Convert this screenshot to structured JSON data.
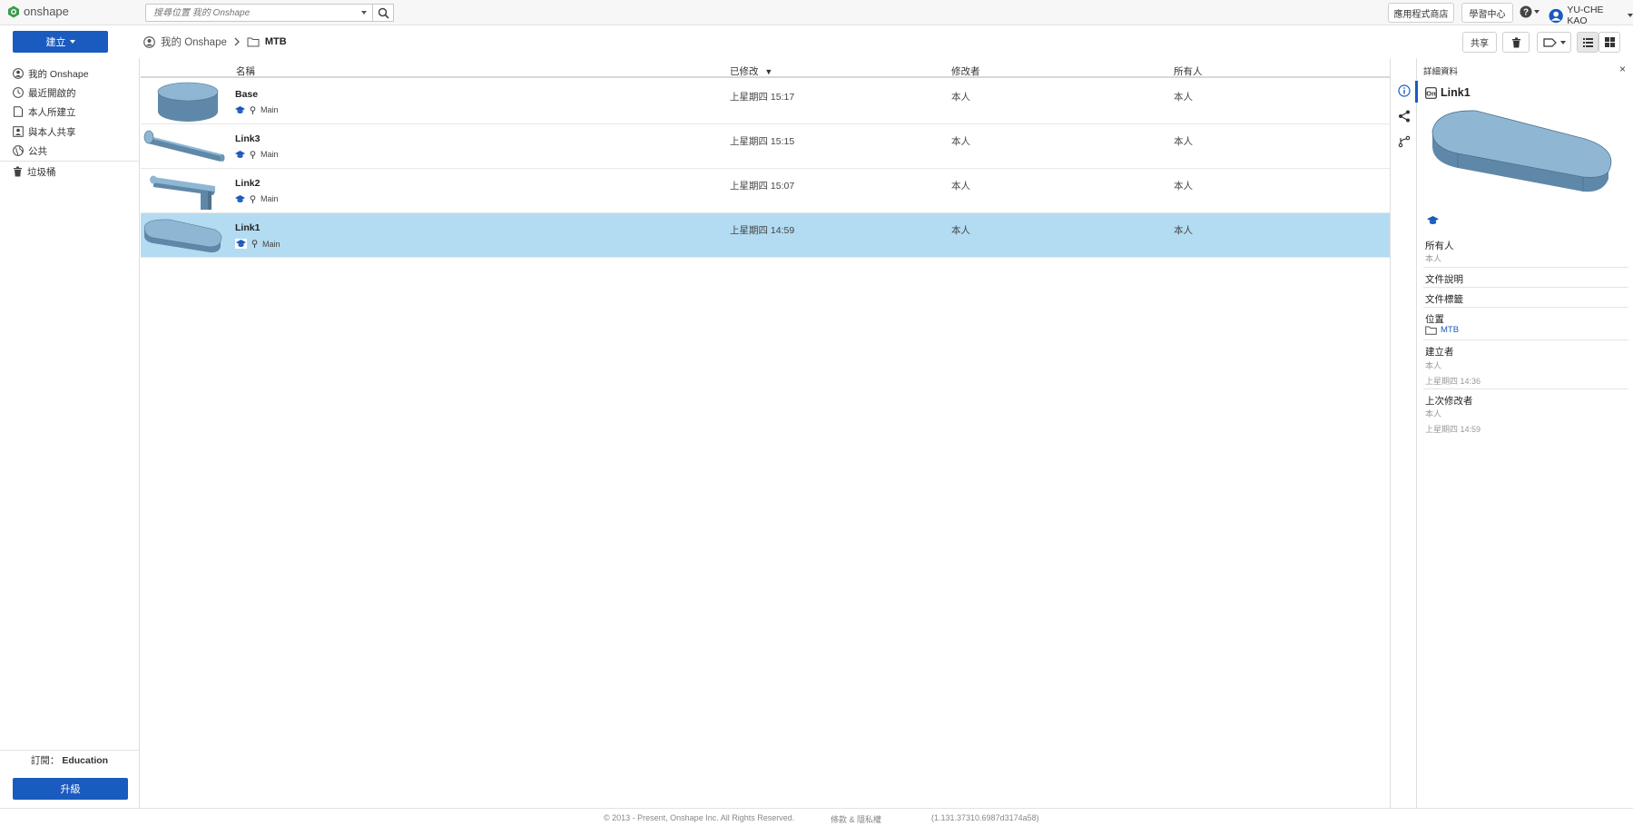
{
  "app": {
    "name": "onshape"
  },
  "search": {
    "placeholder": "搜尋位置 我的 Onshape"
  },
  "topbar": {
    "app_store_label": "應用程式商店",
    "learning_label": "學習中心",
    "user_name": "YU-CHE KAO"
  },
  "toolbar": {
    "create_label": "建立",
    "share_label": "共享"
  },
  "breadcrumb": {
    "root": "我的 Onshape",
    "current": "MTB"
  },
  "sidebar": {
    "items": [
      {
        "label": "我的 Onshape",
        "icon": "user-circle-icon"
      },
      {
        "label": "最近開啟的",
        "icon": "clock-icon"
      },
      {
        "label": "本人所建立",
        "icon": "document-icon"
      },
      {
        "label": "與本人共享",
        "icon": "shared-user-icon"
      },
      {
        "label": "公共",
        "icon": "globe-icon"
      },
      {
        "label": "垃圾桶",
        "icon": "trash-icon"
      }
    ],
    "plan_label": "訂閱：",
    "plan_value": "Education",
    "upgrade_label": "升級"
  },
  "table": {
    "columns": {
      "name": "名稱",
      "modified": "已修改",
      "modified_by": "修改者",
      "owner": "所有人"
    },
    "sort_indicator": "▼",
    "rows": [
      {
        "name": "Base",
        "branch": "Main",
        "modified": "上星期四 15:17",
        "modified_by": "本人",
        "owner": "本人",
        "selected": false
      },
      {
        "name": "Link3",
        "branch": "Main",
        "modified": "上星期四 15:15",
        "modified_by": "本人",
        "owner": "本人",
        "selected": false
      },
      {
        "name": "Link2",
        "branch": "Main",
        "modified": "上星期四 15:07",
        "modified_by": "本人",
        "owner": "本人",
        "selected": false
      },
      {
        "name": "Link1",
        "branch": "Main",
        "modified": "上星期四 14:59",
        "modified_by": "本人",
        "owner": "本人",
        "selected": true
      }
    ]
  },
  "details": {
    "header": "詳細資料",
    "close_glyph": "×",
    "title": "Link1",
    "owner_label": "所有人",
    "owner_value": "本人",
    "description_label": "文件說明",
    "tags_label": "文件標籤",
    "location_label": "位置",
    "location_value": "MTB",
    "created_by_label": "建立者",
    "created_by_value": "本人",
    "created_time": "上星期四 14:36",
    "last_modified_label": "上次修改者",
    "last_modified_value": "本人",
    "last_modified_time": "上星期四 14:59"
  },
  "footer": {
    "copyright": "© 2013 - Present, Onshape Inc. All Rights Reserved.",
    "terms": "條款 & 隱私權",
    "version": "(1.131.37310.6987d3174a58)"
  },
  "colors": {
    "accent": "#1a5bbf",
    "selected_row": "#b3dcf2",
    "part": "#7ea9c9"
  }
}
